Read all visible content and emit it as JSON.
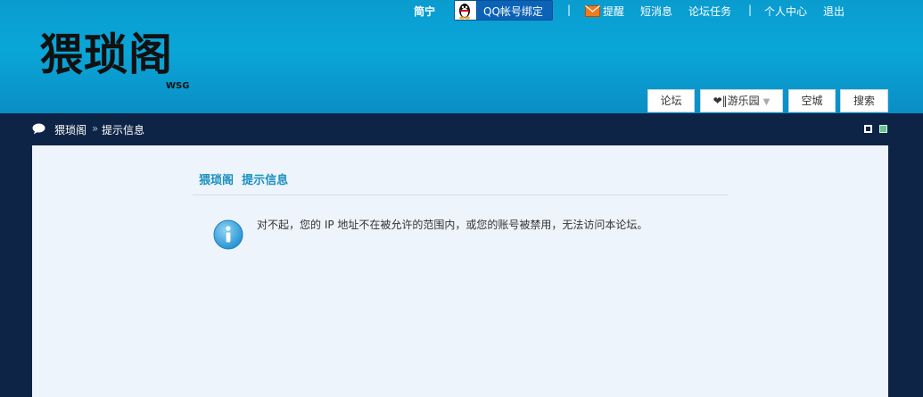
{
  "header": {
    "logo": "猥琐阁",
    "logo_sub": "WSG",
    "topbar": {
      "username": "简宁",
      "qq_bind_label": "QQ帐号绑定",
      "separator": "|",
      "remind": "提醒",
      "messages": "短消息",
      "tasks": "论坛任务",
      "profile": "个人中心",
      "logout": "退出"
    },
    "nav": {
      "forum": "论坛",
      "playground": "❤‖游乐园",
      "space": "空城",
      "search": "搜索"
    }
  },
  "breadcrumb": {
    "home": "猥琐阁",
    "separator": "»",
    "current": "提示信息"
  },
  "message": {
    "title_site": "猥琐阁",
    "title_page": "提示信息",
    "text": "对不起，您的 IP 地址不在被允许的范围内，或您的账号被禁用，无法访问本论坛。"
  },
  "colors": {
    "header_blue": "#0aa6d8",
    "navy": "#0e2447",
    "content_bg": "#eef4fb",
    "title_blue": "#1a8fbf"
  }
}
